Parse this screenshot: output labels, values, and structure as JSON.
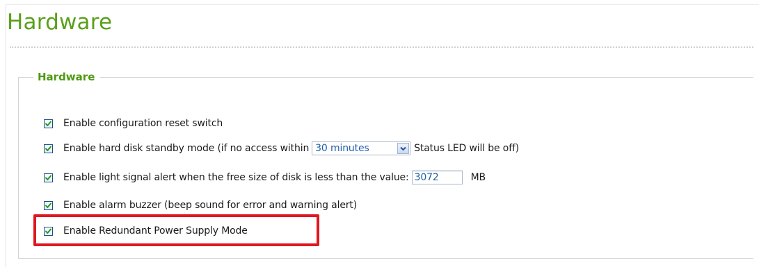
{
  "page": {
    "title": "Hardware"
  },
  "section": {
    "legend": "Hardware"
  },
  "options": [
    {
      "label": "Enable configuration reset switch",
      "checked": true
    },
    {
      "label_before": "Enable hard disk standby mode (if no access within",
      "select_value": "30 minutes",
      "label_after": "Status LED will be off)",
      "checked": true
    },
    {
      "label_before": "Enable light signal alert when the free size of disk is less than the value:",
      "input_value": "3072",
      "unit": "MB",
      "checked": true
    },
    {
      "label": "Enable alarm buzzer (beep sound for error and warning alert)",
      "checked": true
    },
    {
      "label": "Enable Redundant Power Supply Mode",
      "checked": true,
      "highlighted": true
    }
  ],
  "colors": {
    "title": "#5aa01c",
    "legend": "#4c9a12",
    "highlight_border": "#e0171f",
    "field_value": "#1f5fa6"
  },
  "icons": {
    "checkbox_check": "checkmark-icon",
    "dropdown_arrow": "chevron-down-icon"
  }
}
